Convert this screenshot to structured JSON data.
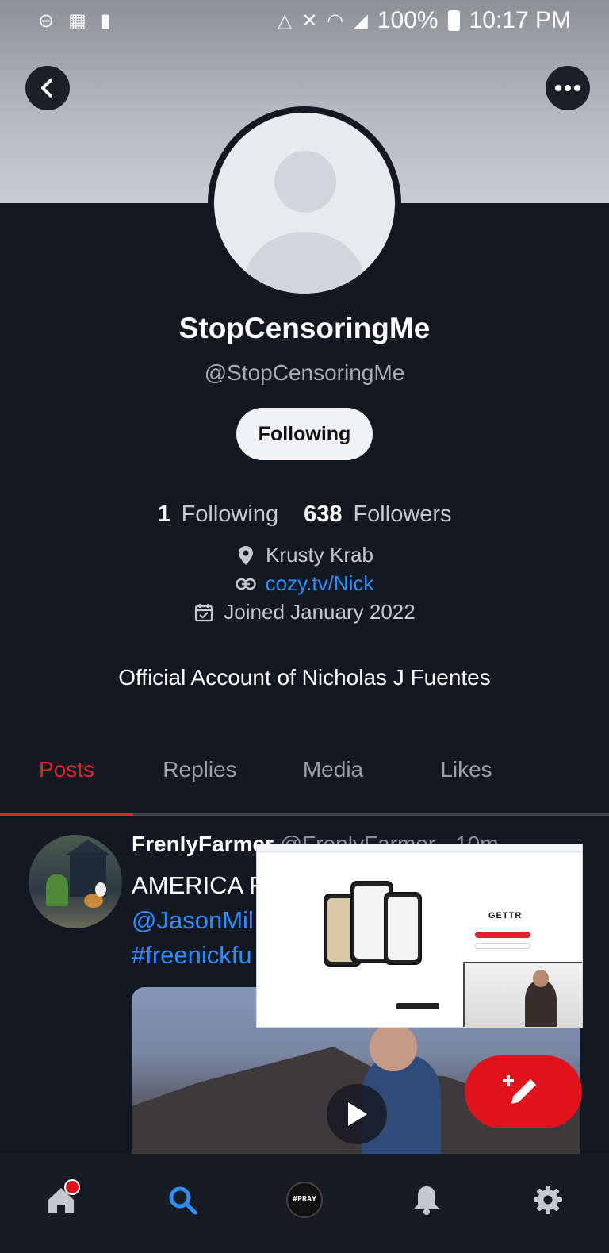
{
  "status_bar": {
    "battery_percent": "100%",
    "time": "10:17 PM",
    "icons": [
      "do-not-disturb-icon",
      "screenshot-icon",
      "battery-saver-icon",
      "data-saver-icon",
      "mute-icon",
      "wifi-icon",
      "signal-icon",
      "battery-icon"
    ]
  },
  "profile": {
    "display_name": "StopCensoringMe",
    "handle": "@StopCensoringMe",
    "follow_button_label": "Following",
    "following_count": "1",
    "following_label": "Following",
    "followers_count": "638",
    "followers_label": "Followers",
    "location": "Krusty Krab",
    "website": "cozy.tv/Nick",
    "joined": "Joined January 2022",
    "bio": "Official Account of Nicholas J Fuentes"
  },
  "tabs": [
    {
      "label": "Posts",
      "active": true
    },
    {
      "label": "Replies",
      "active": false
    },
    {
      "label": "Media",
      "active": false
    },
    {
      "label": "Likes",
      "active": false
    }
  ],
  "post": {
    "author": "FrenlyFarmer",
    "author_handle_partial": "@FrenlyFarmer · 10m",
    "line1": "AMERICA F",
    "line2": "@JasonMil",
    "line3": "#freenickfu"
  },
  "pip_overlay": {
    "logo": "GETTR"
  },
  "bottom_nav": {
    "pray_badge": "#PRAY",
    "items": [
      "home-icon",
      "search-icon",
      "pray-icon",
      "bell-icon",
      "settings-icon"
    ]
  },
  "colors": {
    "background": "#131922",
    "accent_red": "#e0262e",
    "link_blue": "#2f8cff",
    "fab_red": "#e0121b"
  }
}
